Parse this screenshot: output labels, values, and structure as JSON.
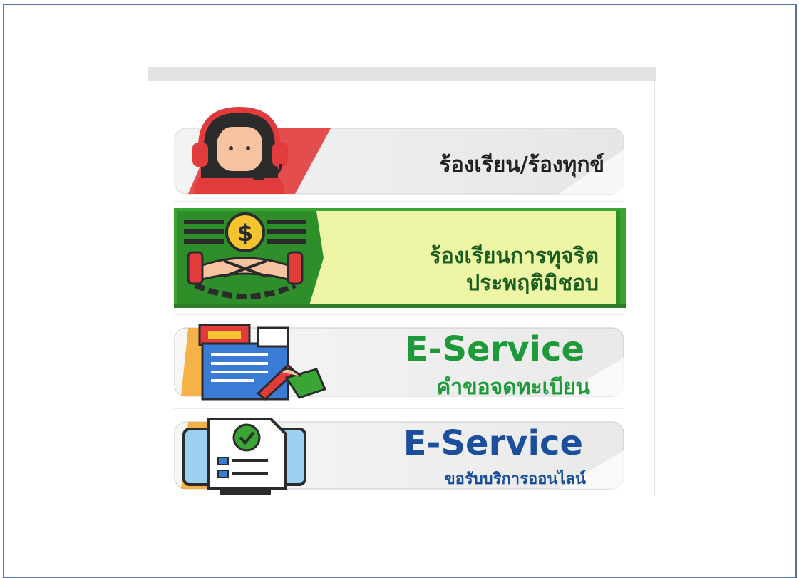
{
  "banners": [
    {
      "id": "complaint",
      "line1": "ร้องเรียน/ร้องทุกข์",
      "text_color": "#222222",
      "accent": "#e23b3b"
    },
    {
      "id": "corruption",
      "line1": "ร้องเรียนการทุจริต",
      "line2": "ประพฤติมิชอบ",
      "text_color": "#1b5e20",
      "accent": "#3aa534",
      "panel_color": "#eef6a6"
    },
    {
      "id": "eservice-register",
      "title": "E-Service",
      "subtitle": "คำขอจดทะเบียน",
      "text_color": "#1f9a3b",
      "accent": "#f4a629"
    },
    {
      "id": "eservice-online",
      "title": "E-Service",
      "subtitle": "ขอรับบริการออนไลน์",
      "text_color": "#1b4f9c",
      "accent": "#f4a629"
    }
  ],
  "icons": [
    "headset-agent-icon",
    "bribe-handcuff-icon",
    "form-pen-icon",
    "monitor-document-icon"
  ]
}
